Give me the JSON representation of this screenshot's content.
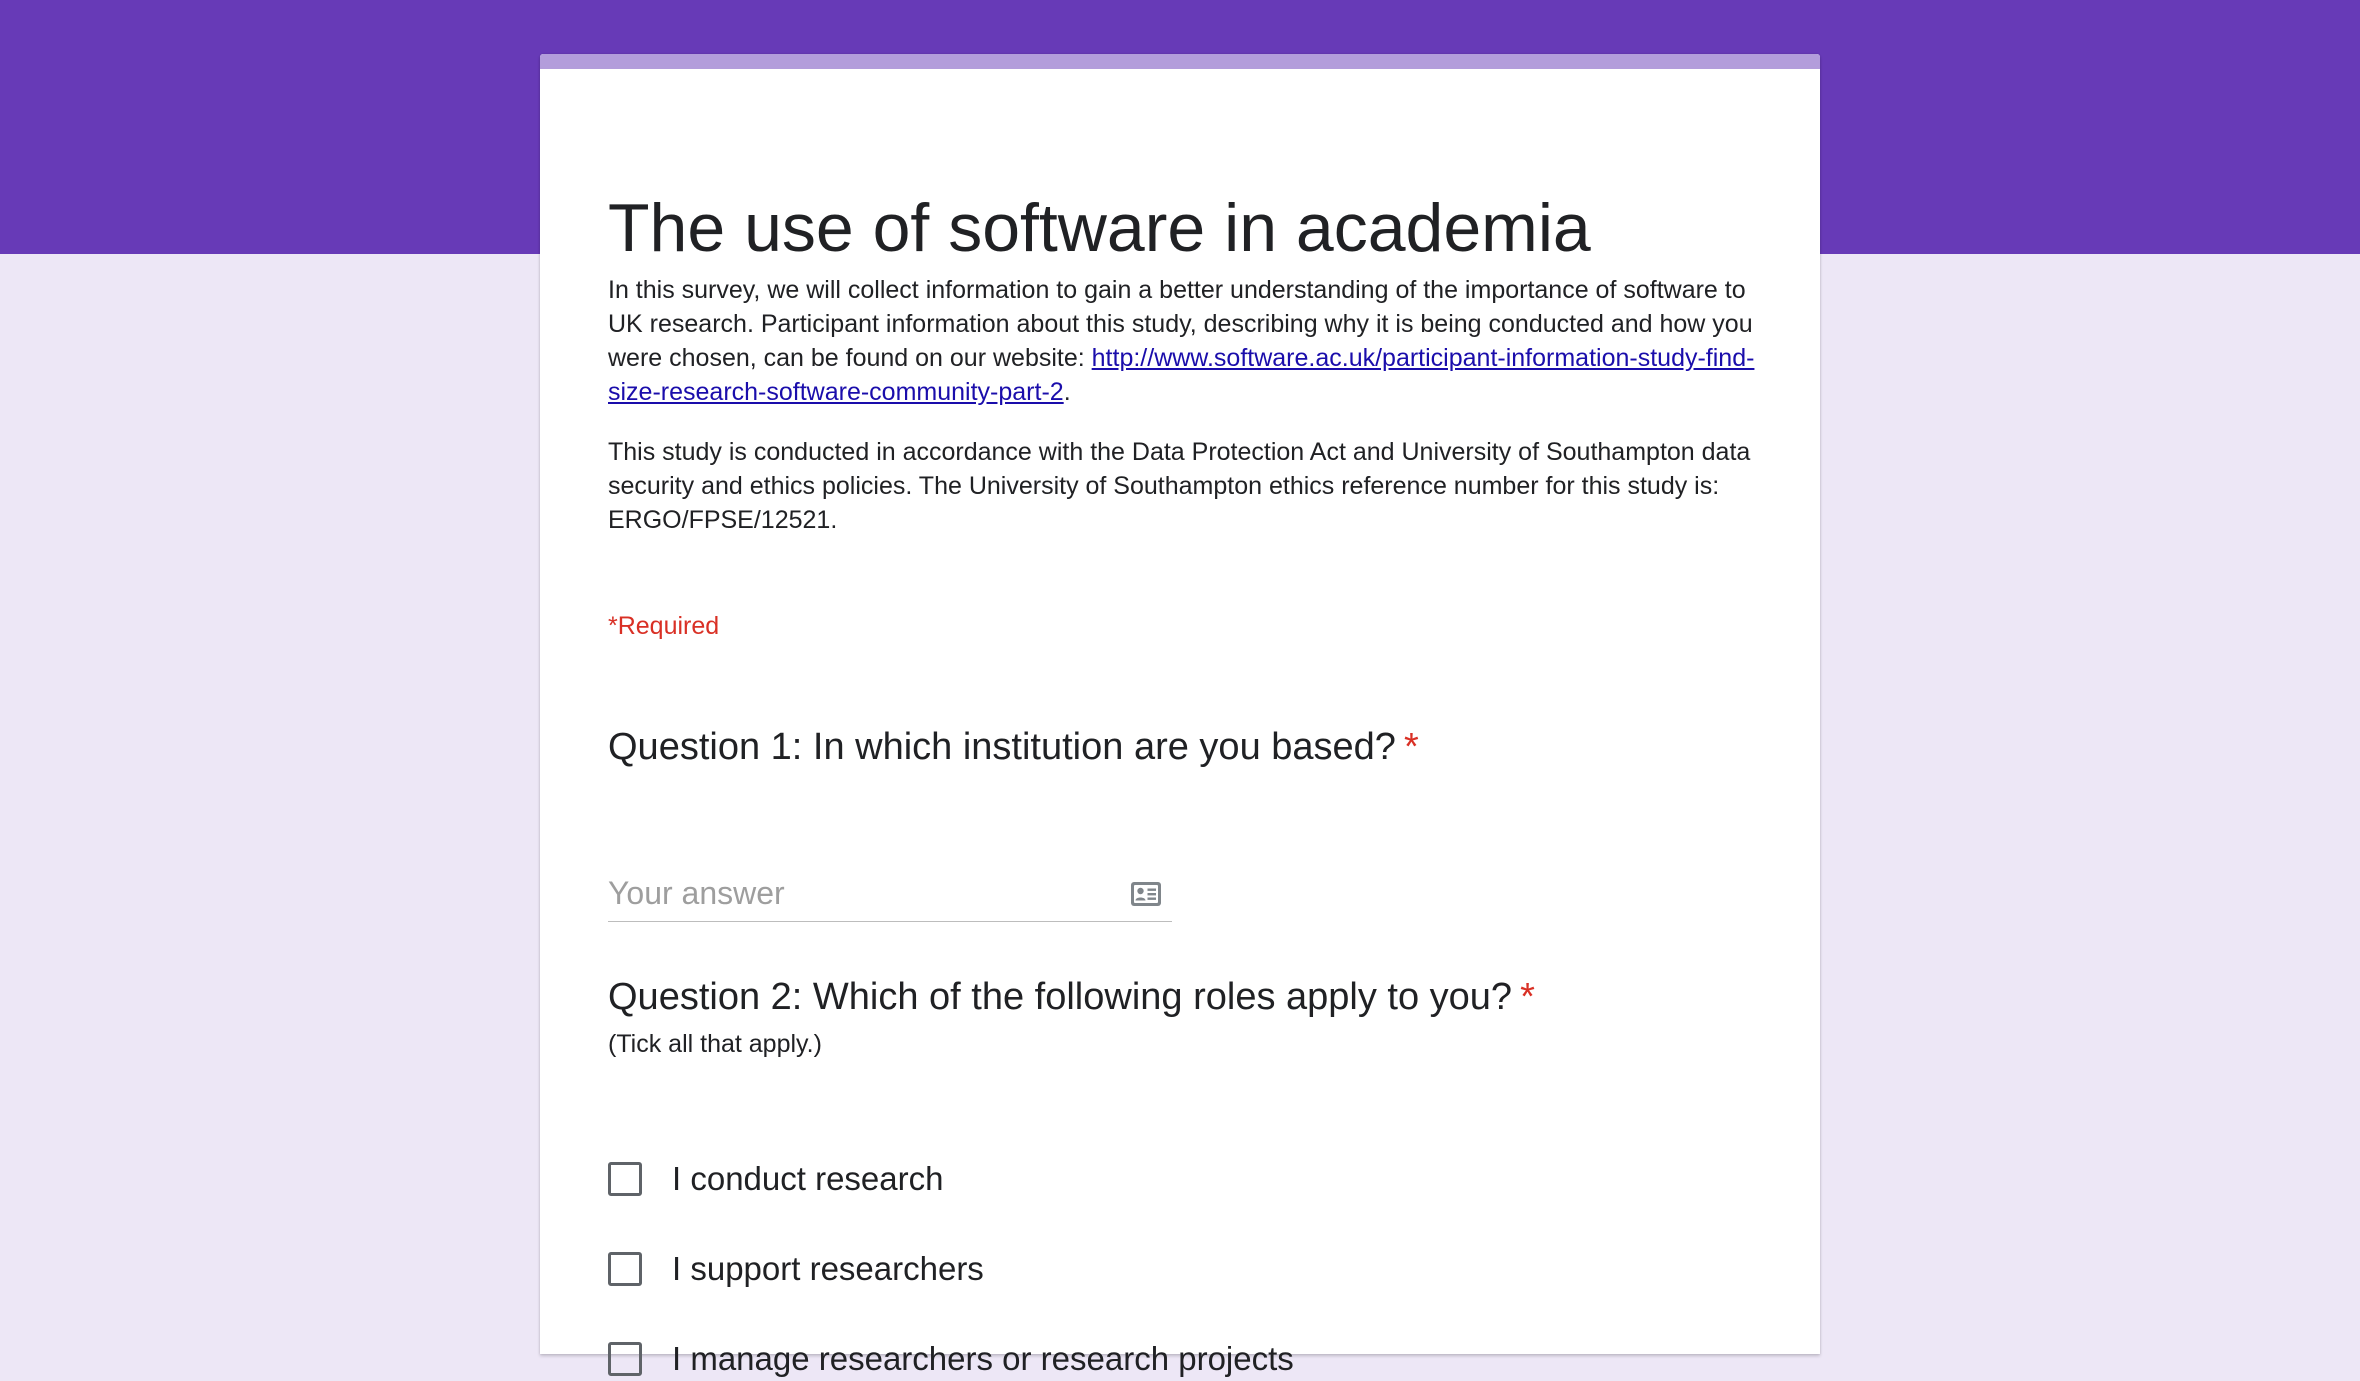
{
  "colors": {
    "header_band": "#673ab7",
    "card_accent": "#b39ddb",
    "page_background": "#ede7f6",
    "required": "#d93025",
    "link": "#1a0dab"
  },
  "form": {
    "title": "The use of software in academia",
    "description": {
      "para1_text": "In this survey, we will collect information to gain a better understanding of the importance of software to UK research. Participant information about this study, describing why it is being conducted and how you were chosen, can be found on our website: ",
      "para1_link": "http://www.software.ac.uk/participant-information-study-find-size-research-software-community-part-2",
      "para1_end": ".",
      "para2_text": "This study is conducted in accordance with the Data Protection Act and University of Southampton data security and ethics policies. The University of Southampton ethics reference number for this study is: ERGO/FPSE/12521."
    },
    "required_note": "*Required"
  },
  "questions": [
    {
      "title": "Question 1: In which institution are you based?",
      "required_marker": "*",
      "answer_placeholder": "Your answer",
      "answer_value": "",
      "icon": "contact-card-icon"
    },
    {
      "title": "Question 2: Which of the following roles apply to you?",
      "required_marker": "*",
      "help": "(Tick all that apply.)",
      "options": [
        {
          "label": "I conduct research",
          "checked": false
        },
        {
          "label": "I support researchers",
          "checked": false
        },
        {
          "label": "I manage researchers or research projects",
          "checked": false
        }
      ]
    }
  ]
}
